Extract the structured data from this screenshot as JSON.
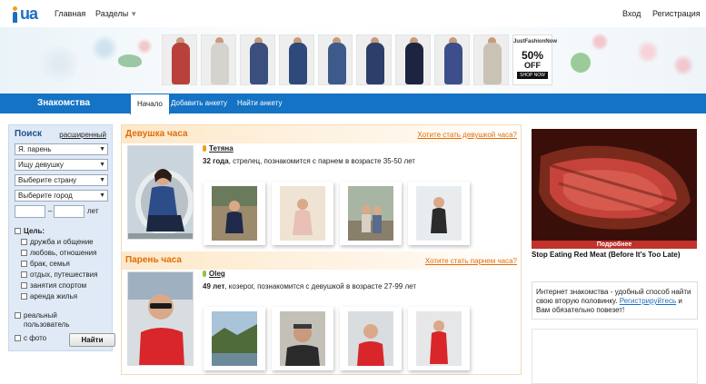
{
  "logo": {
    "text": "ua"
  },
  "topnav": {
    "home": "Главная",
    "sections": "Разделы",
    "login": "Вход",
    "register": "Регистрация"
  },
  "ad_banner": {
    "brand": "JustFashionNow",
    "discount": "50%",
    "off": "OFF",
    "shop": "SHOP NOW"
  },
  "bluebar": {
    "title": "Знакомства",
    "tabs": [
      "Начало",
      "Добавить анкету",
      "Найти анкету"
    ]
  },
  "search": {
    "title": "Поиск",
    "advanced": "расширенный",
    "i_am": "Я. парень",
    "looking_for": "Ищу девушку",
    "country_placeholder": "Выберите страну",
    "city_placeholder": "Выберите город",
    "age_sep": "–",
    "age_unit": "лет",
    "goal_label": "Цель:",
    "goals": [
      "дружба и общение",
      "любовь, отношения",
      "брак, семья",
      "отдых, путешествия",
      "занятия спортом",
      "аренда жилья"
    ],
    "real_user": "реальный пользователь",
    "with_photo": "с фото",
    "find_button": "Найти"
  },
  "girl_of_hour": {
    "title": "Девушка часа",
    "link": "Хотите стать девушкой часа?",
    "name": "Тетяна",
    "age": "32 года",
    "desc": ", стрелец, познакомится с парнем в возрасте 35-50 лет"
  },
  "guy_of_hour": {
    "title": "Парень часа",
    "link": "Хотите стать парнем часа?",
    "name": "Oleg",
    "age": "49 лет",
    "desc": ", козерог, познакомится с девушкой в возрасте 27-99 лет"
  },
  "right_ad": {
    "label": "Подробнее",
    "headline": "Stop Eating Red Meat (Before It's Too Late)"
  },
  "promo": {
    "text_before": "Интернет знакомства - удобный способ найти свою вторую половинку. ",
    "link": "Регистрируйтесь",
    "text_after": " и Вам обязательно повезет!"
  },
  "colors": {
    "brand_blue": "#1473c4",
    "accent_orange": "#e06d0a"
  }
}
